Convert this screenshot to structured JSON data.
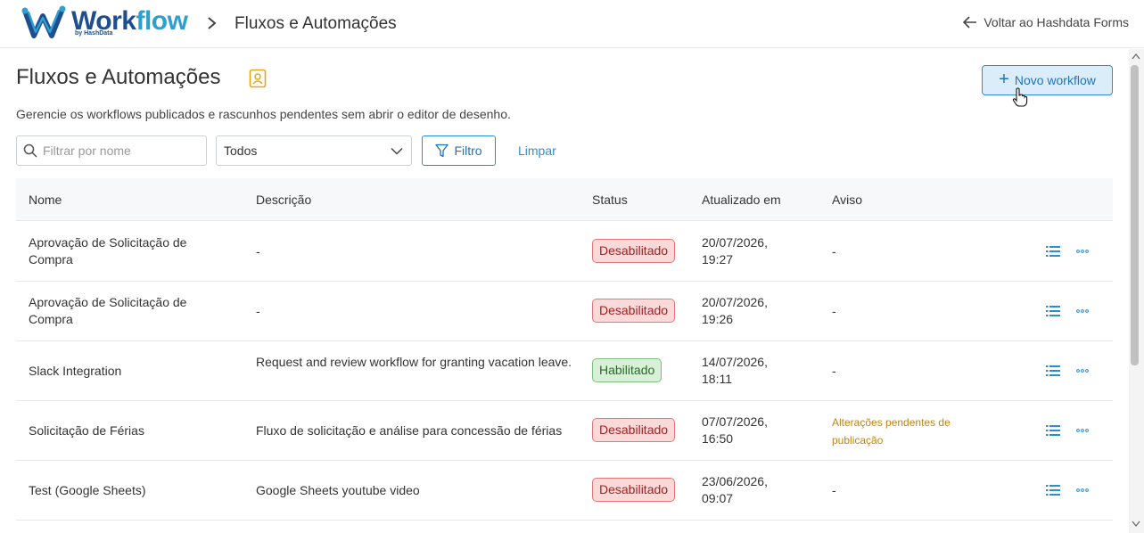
{
  "header": {
    "logo_main_1": "Work",
    "logo_main_2": "flow",
    "logo_sub": "by HashData",
    "breadcrumb_title": "Fluxos e Automações",
    "back_link": "Voltar ao Hashdata Forms"
  },
  "page": {
    "title": "Fluxos e Automações",
    "subtitle": "Gerencie os workflows publicados e rascunhos pendentes sem abrir o editor de desenho.",
    "new_button": "Novo workflow"
  },
  "filters": {
    "search_placeholder": "Filtrar por nome",
    "search_value": "",
    "status_selected": "Todos",
    "filter_button": "Filtro",
    "clear_link": "Limpar"
  },
  "table": {
    "columns": [
      "Nome",
      "Descrição",
      "Status",
      "Atualizado em",
      "Aviso"
    ],
    "rows": [
      {
        "name": "Aprovação de Solicitação de Compra",
        "description": "-",
        "status": "Desabilitado",
        "updated": "20/07/2026, 19:27",
        "warning": "-"
      },
      {
        "name": "Aprovação de Solicitação de Compra",
        "description": "-",
        "status": "Desabilitado",
        "updated": "20/07/2026, 19:26",
        "warning": "-"
      },
      {
        "name": "Slack Integration",
        "description": "Request and review workflow for granting vacation leave.",
        "status": "Habilitado",
        "updated": "14/07/2026, 18:11",
        "warning": "-"
      },
      {
        "name": "Solicitação de Férias",
        "description": "Fluxo de solicitação e análise para concessão de férias",
        "status": "Desabilitado",
        "updated": "07/07/2026, 16:50",
        "warning": "Alterações pendentes de publicação"
      },
      {
        "name": "Test (Google Sheets)",
        "description": "Google Sheets youtube video",
        "status": "Desabilitado",
        "updated": "23/06/2026, 09:07",
        "warning": "-"
      }
    ]
  },
  "colors": {
    "accent": "#2b8fcf",
    "disabled_badge_bg": "#fbd9d9",
    "enabled_badge_bg": "#d8f0d8",
    "warning_text": "#c08414"
  }
}
